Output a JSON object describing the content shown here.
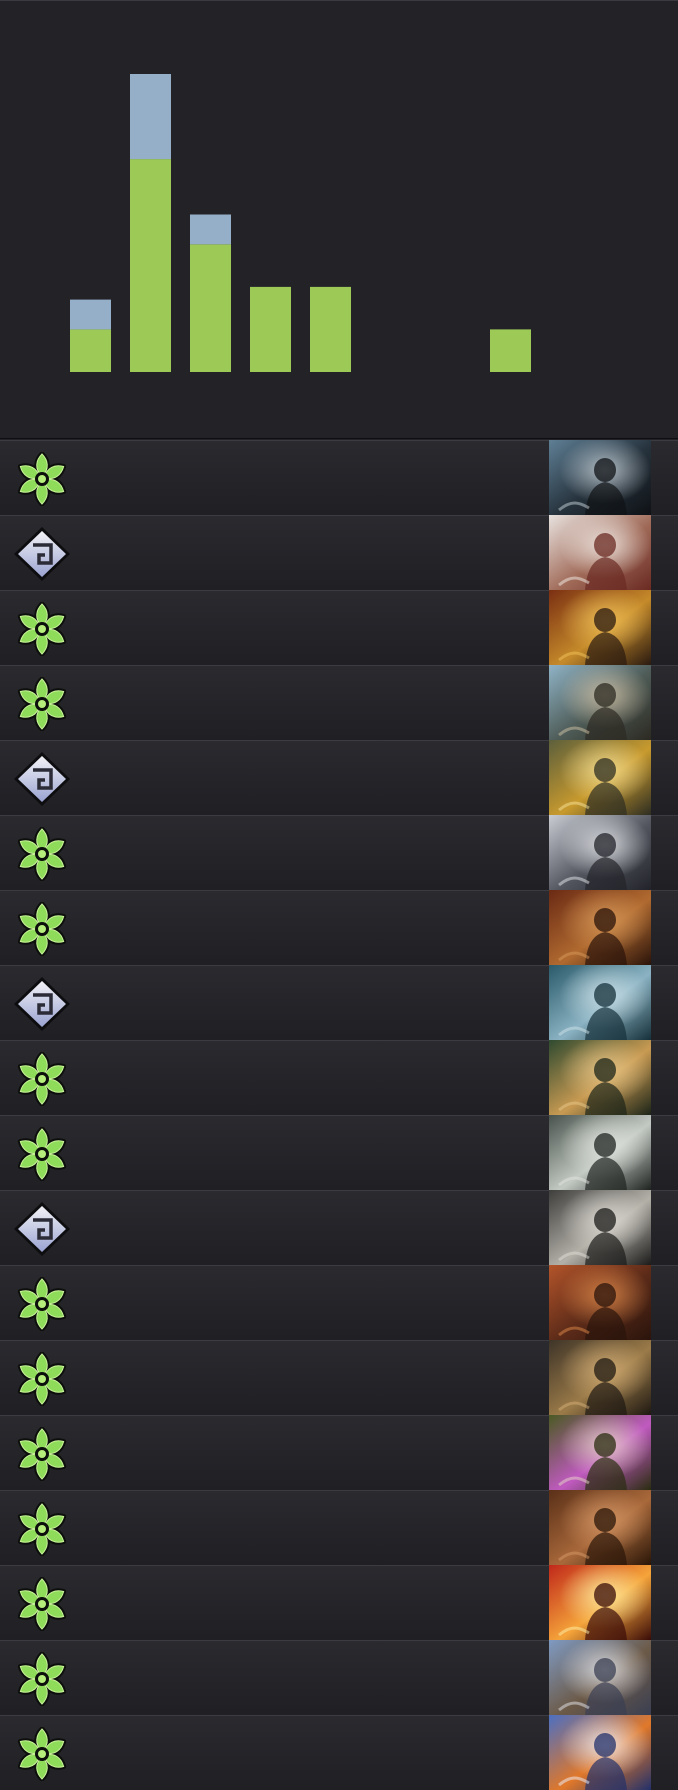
{
  "colors": {
    "background": "#232327",
    "bar_primary": "#9dca57",
    "bar_secondary": "#95afc9",
    "symbol_green": "#8fdc5a",
    "symbol_silver": "#c9cedd"
  },
  "chart_data": {
    "type": "bar",
    "stacked": true,
    "categories": [
      "1",
      "2",
      "3",
      "4",
      "5",
      "6",
      "7",
      "8"
    ],
    "series": [
      {
        "color": "#9dca57",
        "values": [
          1,
          5,
          3,
          2,
          2,
          0,
          0,
          1
        ]
      },
      {
        "color": "#95afc9",
        "values": [
          0.7,
          2,
          0.7,
          0,
          0,
          0,
          0,
          0
        ]
      }
    ],
    "ylim": [
      0,
      7
    ],
    "grid": false,
    "axis_labels_visible": false
  },
  "cards": [
    {
      "type": "green",
      "icon": "green-star-icon",
      "art": "hooded-figure-serpent"
    },
    {
      "type": "silver",
      "icon": "silver-rune-icon",
      "art": "brown-red-wings"
    },
    {
      "type": "green",
      "icon": "green-star-icon",
      "art": "horned-warrior-torch"
    },
    {
      "type": "green",
      "icon": "green-star-icon",
      "art": "bearded-swordsman"
    },
    {
      "type": "silver",
      "icon": "silver-rune-icon",
      "art": "golden-spellcaster"
    },
    {
      "type": "green",
      "icon": "green-star-icon",
      "art": "armored-knight-snow"
    },
    {
      "type": "green",
      "icon": "green-star-icon",
      "art": "furry-beast"
    },
    {
      "type": "silver",
      "icon": "silver-rune-icon",
      "art": "blue-stone-statue"
    },
    {
      "type": "green",
      "icon": "green-star-icon",
      "art": "forest-maidens"
    },
    {
      "type": "green",
      "icon": "green-star-icon",
      "art": "pale-golem"
    },
    {
      "type": "silver",
      "icon": "silver-rune-icon",
      "art": "armored-archer"
    },
    {
      "type": "green",
      "icon": "green-star-icon",
      "art": "red-dwarf-warrior"
    },
    {
      "type": "green",
      "icon": "green-star-icon",
      "art": "goblin-shaman"
    },
    {
      "type": "green",
      "icon": "green-star-icon",
      "art": "flower-skull"
    },
    {
      "type": "green",
      "icon": "green-star-icon",
      "art": "brown-hulking-creature"
    },
    {
      "type": "green",
      "icon": "green-star-icon",
      "art": "fire-lava"
    },
    {
      "type": "green",
      "icon": "green-star-icon",
      "art": "antlered-helm-warrior"
    },
    {
      "type": "green",
      "icon": "green-star-icon",
      "art": "fire-beast-winter"
    }
  ]
}
